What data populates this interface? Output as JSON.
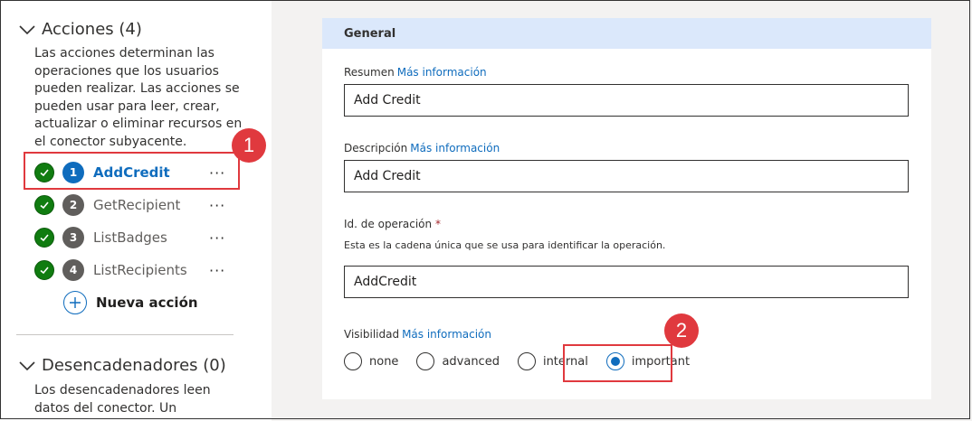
{
  "actions_section": {
    "title": "Acciones (4)",
    "description_lines": [
      "Las acciones determinan las",
      "operaciones que los usuarios",
      "pueden realizar. Las acciones se",
      "pueden usar para leer, crear,",
      "actualizar o eliminar recursos en",
      "el conector subyacente."
    ],
    "items": [
      {
        "number": "1",
        "name": "AddCredit",
        "more": "···"
      },
      {
        "number": "2",
        "name": "GetRecipient",
        "more": "···"
      },
      {
        "number": "3",
        "name": "ListBadges",
        "more": "···"
      },
      {
        "number": "4",
        "name": "ListRecipients",
        "more": "···"
      }
    ],
    "new_action_label": "Nueva acción"
  },
  "triggers_section": {
    "title": "Desencadenadores (0)",
    "description_lines": [
      "Los desencadenadores leen",
      "datos del conector. Un"
    ]
  },
  "callouts": [
    "1",
    "2"
  ],
  "general": {
    "header": "General",
    "more_info": "Más información",
    "summary_label": "Resumen",
    "summary_value": "Add Credit",
    "description_label": "Descripción",
    "description_value": "Add Credit",
    "operation_id_label": "Id. de operación",
    "required_mark": "*",
    "operation_id_hint": "Esta es la cadena única que se usa para identificar la operación.",
    "operation_id_value": "AddCredit",
    "visibility_label": "Visibilidad",
    "visibility_options": [
      "none",
      "advanced",
      "internal",
      "important"
    ],
    "visibility_selected": "important"
  },
  "colors": {
    "accent": "#0f6cbd",
    "success": "#107c10",
    "callout": "#e0393e",
    "header_bg": "#dbe8fb"
  }
}
